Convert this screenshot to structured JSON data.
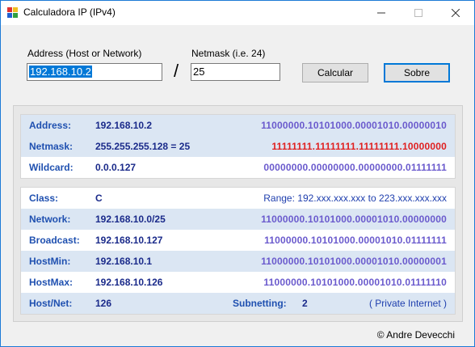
{
  "window": {
    "title": "Calculadora IP (IPv4)",
    "controls": {
      "minimize_icon": "–",
      "maximize_icon": "☐",
      "close_icon": "✕"
    }
  },
  "form": {
    "address_label": "Address (Host or Network)",
    "address_value": "192.168.10.2",
    "separator": "/",
    "netmask_label": "Netmask (i.e. 24)",
    "netmask_value": "25",
    "calc_button": "Calcular",
    "about_button": "Sobre"
  },
  "top_panel": {
    "rows": [
      {
        "label": "Address:",
        "value": "192.168.10.2",
        "binary": "11000000.10101000.00001010.00000010"
      },
      {
        "label": "Netmask:",
        "value": "255.255.255.128 = 25",
        "binary": "11111111.11111111.11111111.10000000"
      },
      {
        "label": "Wildcard:",
        "value": "0.0.0.127",
        "binary": "00000000.00000000.00000000.01111111"
      }
    ]
  },
  "bottom_panel": {
    "class_row": {
      "label": "Class:",
      "value": "C",
      "range": "Range:  192.xxx.xxx.xxx  to  223.xxx.xxx.xxx"
    },
    "rows": [
      {
        "label": "Network:",
        "value": "192.168.10.0/25",
        "binary": "11000000.10101000.00001010.00000000"
      },
      {
        "label": "Broadcast:",
        "value": "192.168.10.127",
        "binary": "11000000.10101000.00001010.01111111"
      },
      {
        "label": "HostMin:",
        "value": "192.168.10.1",
        "binary": "11000000.10101000.00001010.00000001"
      },
      {
        "label": "HostMax:",
        "value": "192.168.10.126",
        "binary": "11000000.10101000.00001010.01111110"
      }
    ],
    "hosts_row": {
      "label": "Host/Net:",
      "value": "126",
      "subnetting_label": "Subnetting:",
      "subnetting_value": "2",
      "type": "( Private Internet )"
    }
  },
  "footer": {
    "credit": "© Andre Devecchi"
  },
  "colors": {
    "accent": "#0078d7",
    "label_blue": "#1f50b0",
    "binary_purple": "#6a5acd",
    "netmask_red": "#e02020",
    "row_shade": "#dbe6f3"
  }
}
